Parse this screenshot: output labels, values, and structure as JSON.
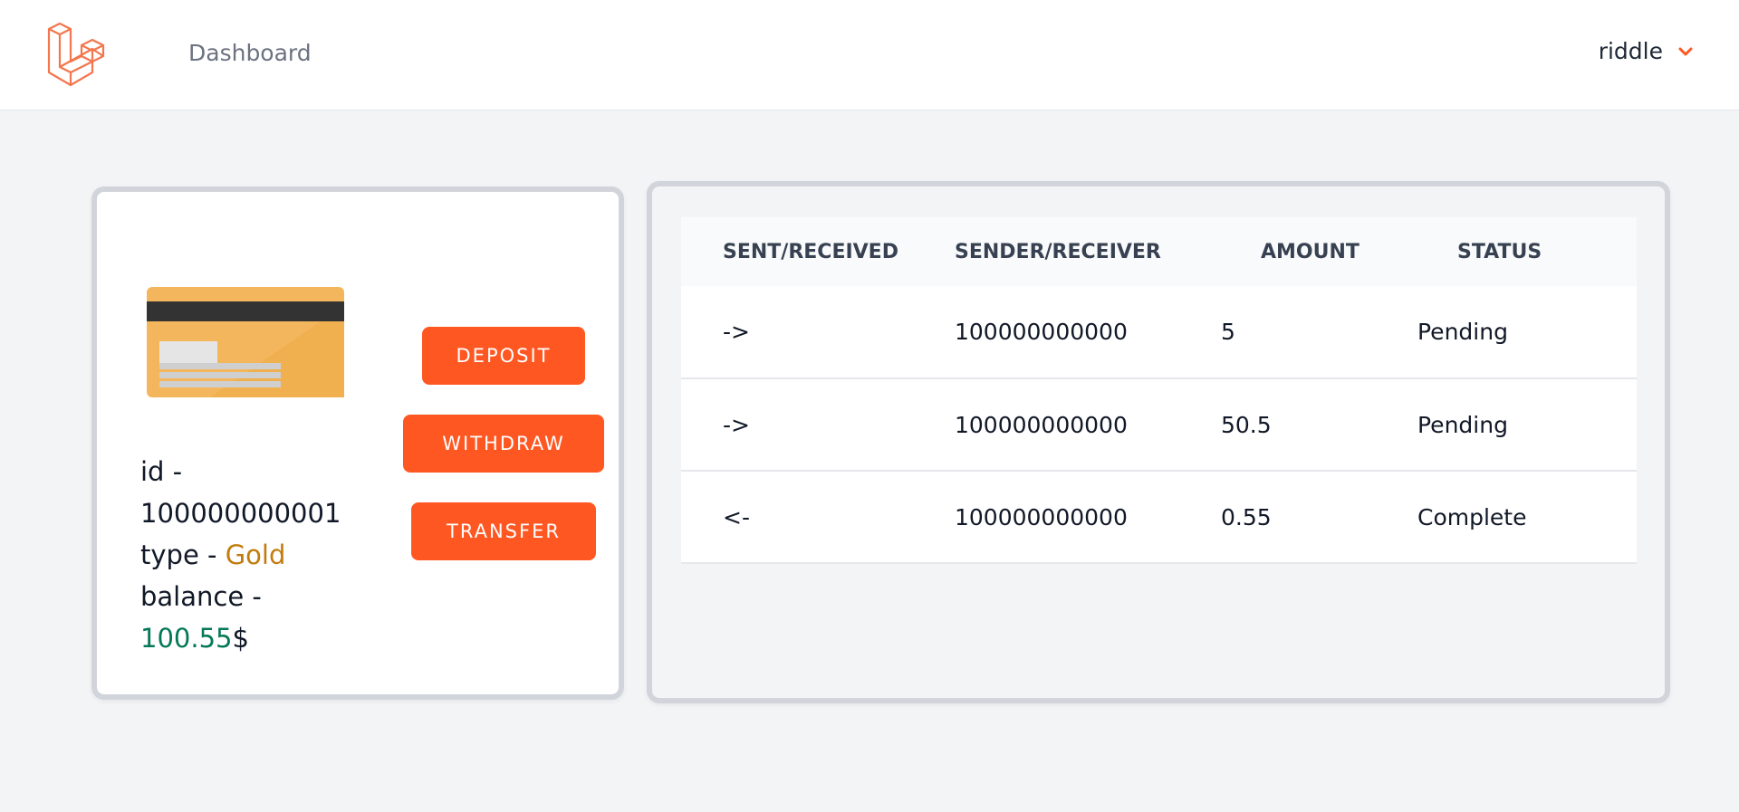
{
  "nav": {
    "dashboard_label": "Dashboard",
    "user_name": "riddle",
    "user_icon": "chevron-down-icon",
    "logo_icon": "laravel-logo-icon"
  },
  "colors": {
    "accent": "#ff5722",
    "gold": "#c27c0e",
    "balance_green": "#047857",
    "complete_green": "#059669",
    "pending_gray": "#9ca3af"
  },
  "card": {
    "id_label": "id -",
    "id_value": "100000000001",
    "type_label": "type -",
    "type_value": "Gold",
    "balance_label": "balance -",
    "balance_value": "100.55",
    "currency": "$",
    "image_icon": "credit-card-icon"
  },
  "actions": {
    "deposit": "DEPOSIT",
    "withdraw": "WITHDRAW",
    "transfer": "TRANSFER"
  },
  "transactions": {
    "headers": [
      "SENT/RECEIVED",
      "SENDER/RECEIVER",
      "AMOUNT",
      "STATUS"
    ],
    "rows": [
      {
        "direction": "->",
        "party": "100000000000",
        "amount": "5",
        "status": "Pending"
      },
      {
        "direction": "->",
        "party": "100000000000",
        "amount": "50.5",
        "status": "Pending"
      },
      {
        "direction": "<-",
        "party": "100000000000",
        "amount": "0.55",
        "status": "Complete"
      }
    ]
  }
}
